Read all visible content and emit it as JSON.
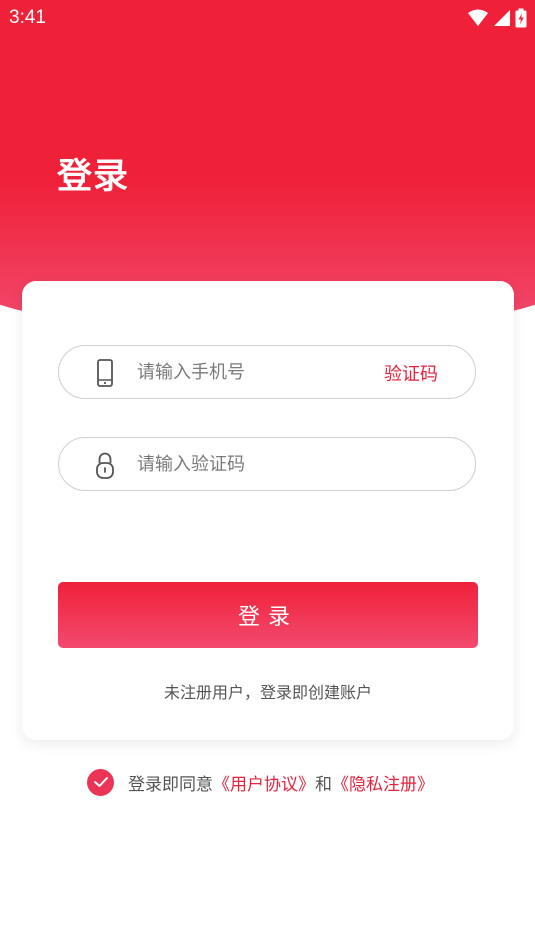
{
  "status_bar": {
    "time": "3:41"
  },
  "header": {
    "title": "登录"
  },
  "form": {
    "phone_placeholder": "请输入手机号",
    "get_code_label": "验证码",
    "code_placeholder": "请输入验证码",
    "login_label": "登录",
    "register_hint": "未注册用户，登录即创建账户"
  },
  "agreement": {
    "checked": true,
    "prefix": "登录即同意",
    "user_agreement": "《用户协议》",
    "conjunction": "和",
    "privacy": "《隐私注册》"
  },
  "colors": {
    "accent": "#ef2139",
    "accent_light": "#f24a6e",
    "link": "#e5233d"
  },
  "icons": {
    "phone_field": "mobile-phone-icon",
    "code_field": "padlock-icon",
    "agreement_check": "check-circle-icon"
  }
}
